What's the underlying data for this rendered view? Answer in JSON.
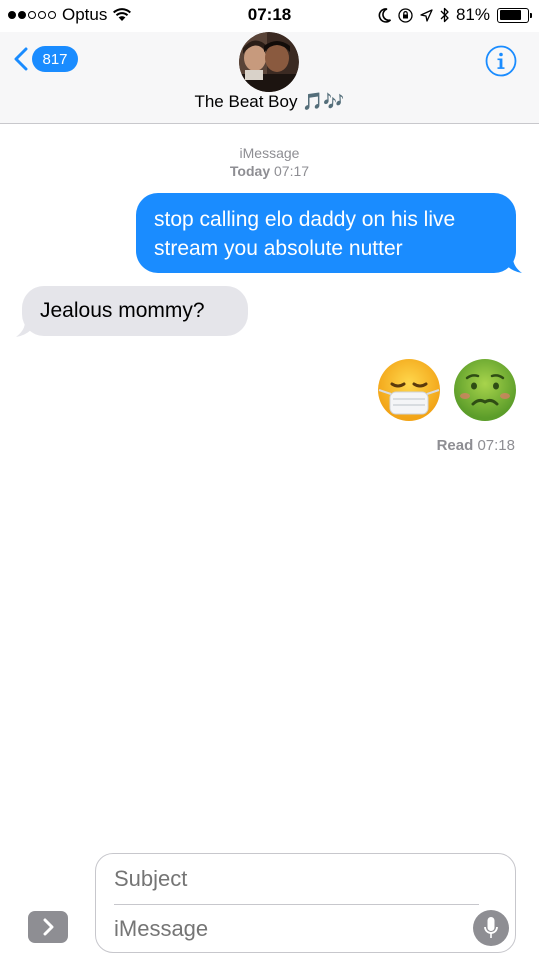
{
  "status_bar": {
    "carrier": "Optus",
    "time": "07:18",
    "battery_percent": "81%",
    "battery_level": 0.81,
    "signal_bars_filled": 2,
    "signal_bars_total": 5
  },
  "header": {
    "back_count": "817",
    "contact_name": "The Beat Boy 🎵🎶",
    "accent_color": "#1a8cff"
  },
  "thread": {
    "service_label": "iMessage",
    "date_label": "Today",
    "date_time": "07:17",
    "messages": [
      {
        "direction": "outgoing",
        "text": "stop calling elo daddy on his live stream you absolute nutter"
      },
      {
        "direction": "incoming",
        "text": "Jealous mommy?"
      },
      {
        "direction": "outgoing",
        "emoji": [
          "face-with-medical-mask",
          "nauseated-face"
        ]
      }
    ],
    "read_label": "Read",
    "read_time": "07:18"
  },
  "composer": {
    "subject_placeholder": "Subject",
    "body_placeholder": "iMessage"
  }
}
